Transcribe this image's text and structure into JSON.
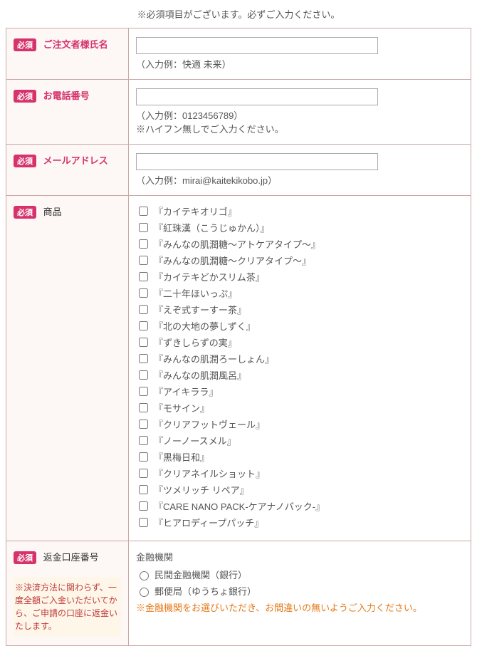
{
  "top_note": "※必須項目がございます。必ずご入力ください。",
  "required_badge": "必須",
  "rows": {
    "name": {
      "label": "ご注文者様氏名",
      "hint": "（入力例：快適 未来）"
    },
    "phone": {
      "label": "お電話番号",
      "hint": "（入力例：0123456789）",
      "note": "※ハイフン無しでご入力ください。"
    },
    "email": {
      "label": "メールアドレス",
      "hint": "（入力例：mirai@kaitekikobo.jp）"
    },
    "products": {
      "label": "商品",
      "items": [
        "『カイテキオリゴ』",
        "『紅珠漢（こうじゅかん）』",
        "『みんなの肌潤糖～アトケアタイプ～』",
        "『みんなの肌潤糖～クリアタイプ～』",
        "『カイテキどかスリム茶』",
        "『二十年ほいっぷ』",
        "『えぞ式すーすー茶』",
        "『北の大地の夢しずく』",
        "『ずきしらずの実』",
        "『みんなの肌潤ろーしょん』",
        "『みんなの肌潤風呂』",
        "『アイキララ』",
        "『モサイン』",
        "『クリアフットヴェール』",
        "『ノーノースメル』",
        "『黒梅日和』",
        "『クリアネイルショット』",
        "『ツメリッチ リペア』",
        "『CARE NANO PACK-ケアナノパック-』",
        "『ヒアロディープパッチ』"
      ]
    },
    "refund": {
      "label": "返金口座番号",
      "sub_label": "金融機関",
      "option1": "民間金融機関（銀行）",
      "option2": "郵便局（ゆうちょ銀行）",
      "warn": "※金融機関をお選びいただき、お間違いの無いようご入力ください。",
      "caution": "※決済方法に関わらず、一度全額ご入金いただいてから、ご申請の口座に返金いたします。"
    }
  }
}
